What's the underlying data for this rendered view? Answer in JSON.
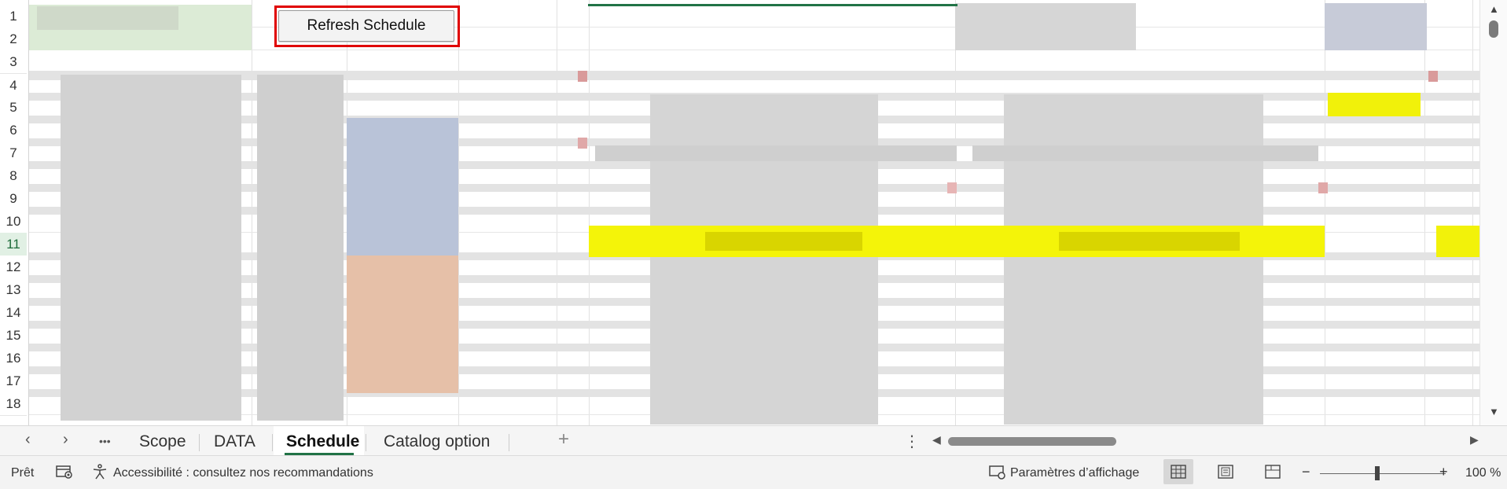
{
  "row_headers": [
    "1",
    "2",
    "3",
    "4",
    "5",
    "6",
    "7",
    "8",
    "9",
    "10",
    "11",
    "12",
    "13",
    "14",
    "15",
    "16",
    "17",
    "18"
  ],
  "selected_row": "11",
  "refresh_button": {
    "label": "Refresh Schedule"
  },
  "sheet_tabs": [
    {
      "label": "Scope",
      "active": false
    },
    {
      "label": "DATA",
      "active": false
    },
    {
      "label": "Schedule",
      "active": true
    },
    {
      "label": "Catalog option",
      "active": false
    }
  ],
  "tab_nav": {
    "prev": "‹",
    "next": "›",
    "more": "•••",
    "add": "+",
    "options": "⋮"
  },
  "status_bar": {
    "ready": "Prêt",
    "accessibility": "Accessibilité : consultez nos recommandations",
    "display_settings": "Paramètres d’affichage",
    "zoom_level": "100 %",
    "zoom_minus": "−",
    "zoom_plus": "+"
  },
  "colors": {
    "highlight_yellow": "#ffff00",
    "accent_green": "#217346",
    "callout_red": "#e00000"
  }
}
